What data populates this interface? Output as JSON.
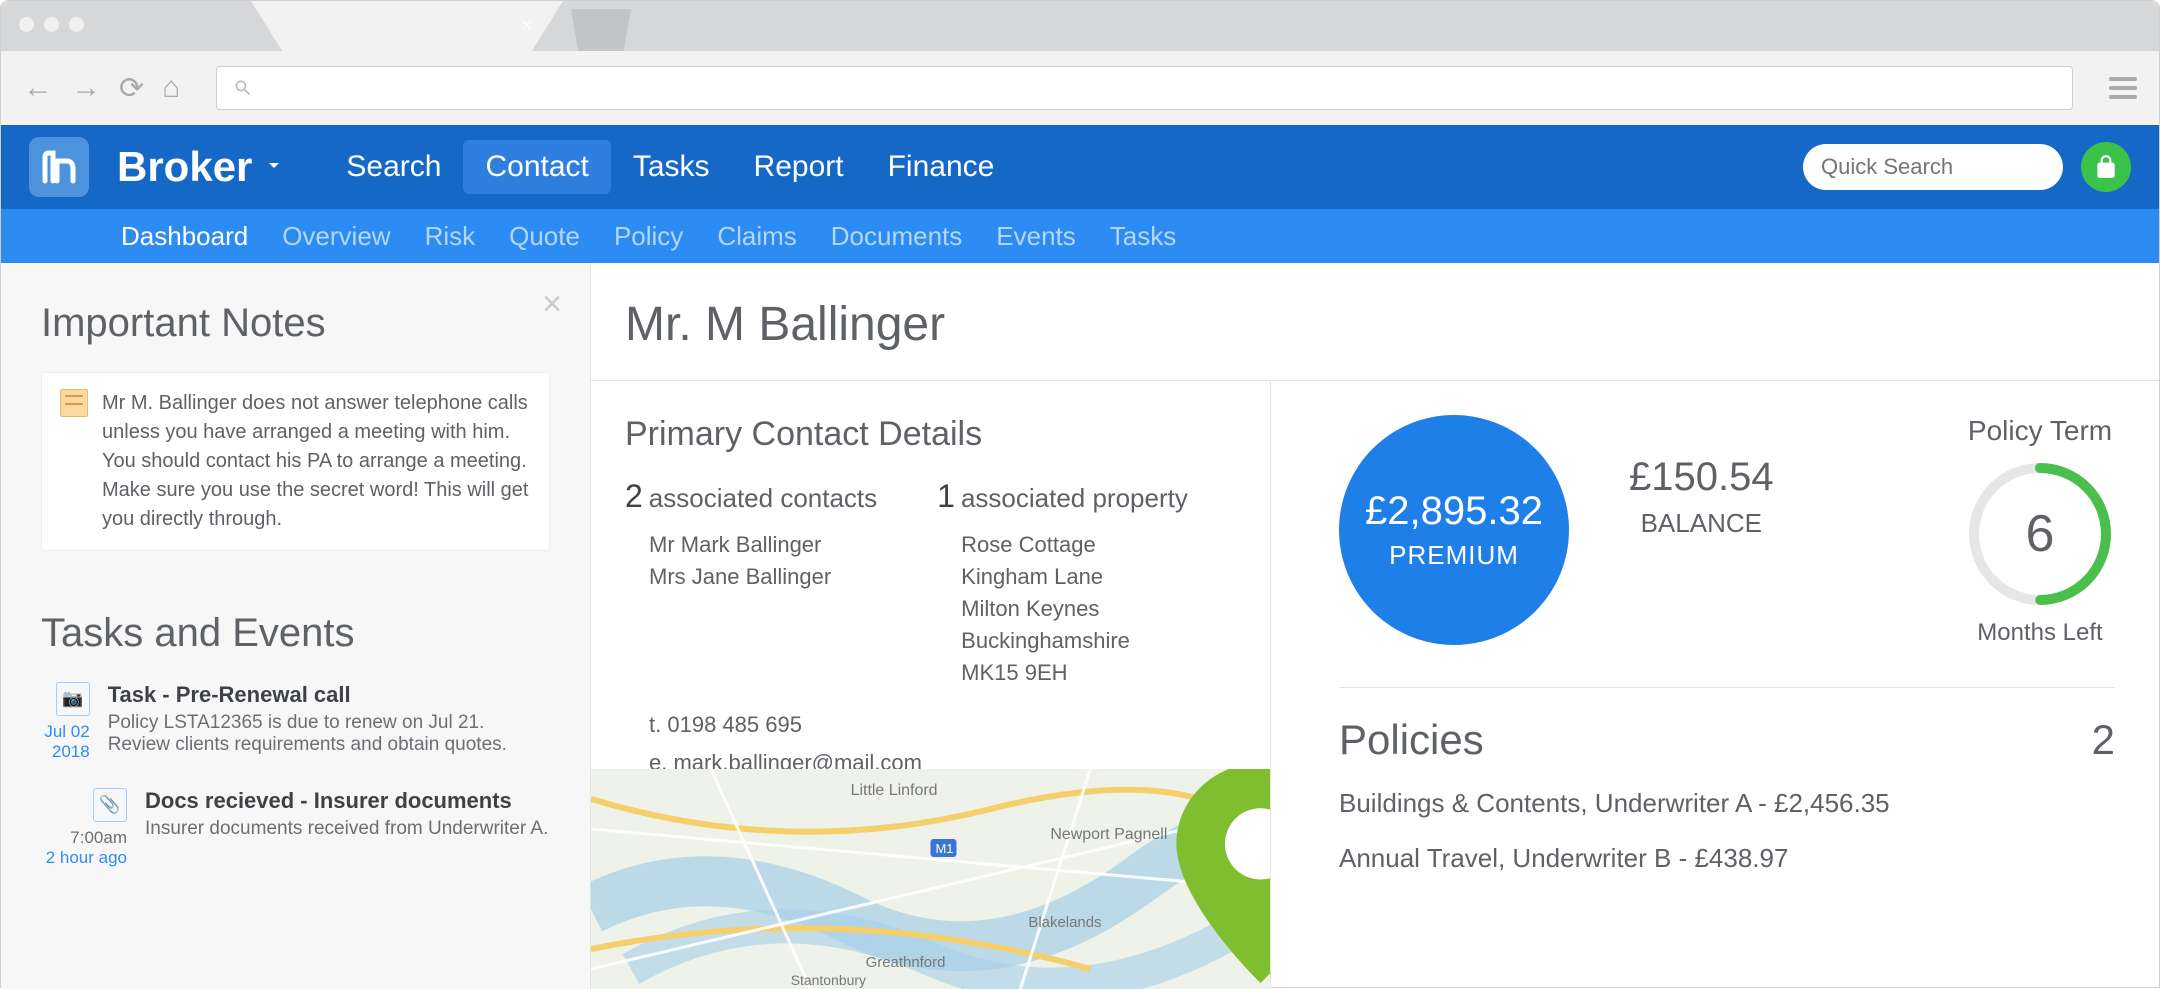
{
  "app": {
    "brand": "Broker"
  },
  "nav": {
    "items": [
      "Search",
      "Contact",
      "Tasks",
      "Report",
      "Finance"
    ],
    "active": "Contact",
    "quick_search_placeholder": "Quick Search"
  },
  "subnav": {
    "items": [
      "Dashboard",
      "Overview",
      "Risk",
      "Quote",
      "Policy",
      "Claims",
      "Documents",
      "Events",
      "Tasks"
    ],
    "active": "Dashboard"
  },
  "sidebar": {
    "notes_heading": "Important Notes",
    "note": "Mr M. Ballinger does not answer telephone calls unless you have arranged a meeting with him. You should contact his PA to arrange a meeting. Make sure you use the secret word! This will get you directly through.",
    "tasks_heading": "Tasks and Events",
    "items": [
      {
        "date": "Jul 02 2018",
        "sub": "",
        "title": "Task - Pre-Renewal call",
        "desc": "Policy LSTA12365 is due to renew on Jul 21. Review clients requirements and obtain quotes.",
        "icon": "camera"
      },
      {
        "date": "7:00am",
        "sub": "2 hour ago",
        "title": "Docs recieved - Insurer documents",
        "desc": "Insurer documents received from Underwriter A.",
        "icon": "paperclip"
      }
    ]
  },
  "contact": {
    "title": "Mr. M Ballinger",
    "details_heading": "Primary Contact Details",
    "assoc_contacts": {
      "count": "2",
      "label": "associated contacts",
      "lines": [
        "Mr Mark Ballinger",
        "Mrs Jane Ballinger"
      ]
    },
    "assoc_property": {
      "count": "1",
      "label": "associated property",
      "lines": [
        "Rose Cottage",
        "Kingham Lane",
        "Milton Keynes",
        "Buckinghamshire",
        "MK15 9EH"
      ]
    },
    "tel_label": "t.",
    "tel": "0198 485 695",
    "email_label": "e.",
    "email": "mark.ballinger@mail.com",
    "map_labels": [
      "Little Linford",
      "Newport Pagnell",
      "Blakelands",
      "Greathnford",
      "Stantonbury"
    ]
  },
  "summary": {
    "premium": {
      "value": "£2,895.32",
      "label": "PREMIUM"
    },
    "balance": {
      "value": "£150.54",
      "label": "BALANCE"
    },
    "term": {
      "title": "Policy Term",
      "value": "6",
      "sub": "Months Left"
    }
  },
  "policies": {
    "heading": "Policies",
    "count": "2",
    "items": [
      "Buildings & Contents, Underwriter A - £2,456.35",
      "Annual Travel, Underwriter B - £438.97"
    ]
  }
}
